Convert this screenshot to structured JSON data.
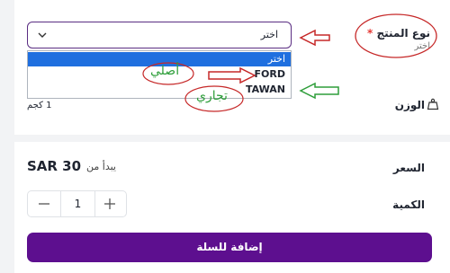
{
  "product_form": {
    "type_field": {
      "label": "نوع المنتج",
      "required_mark": "*",
      "hint": "اختر",
      "selected_value": "اختر",
      "options": [
        "اختر",
        "FORD",
        "TAWAN"
      ]
    },
    "weight": {
      "label": "الوزن",
      "value": "1 كجم"
    },
    "price": {
      "label": "السعر",
      "prefix": "يبدأ من",
      "amount": "SAR 30"
    },
    "quantity": {
      "label": "الكمية",
      "value": "1"
    },
    "add_to_cart_label": "إضافة للسلة"
  },
  "annotations": {
    "original_label": "أصلي",
    "commercial_label": "تجاري"
  },
  "colors": {
    "brand_purple": "#5d0f8f",
    "selected_option_bg": "#1f6fdf",
    "annotation_red": "#c62828",
    "annotation_green": "#2e9e3a"
  }
}
